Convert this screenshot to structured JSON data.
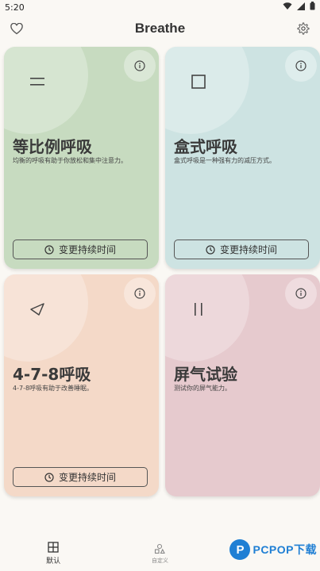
{
  "status": {
    "time": "5:20",
    "icons": [
      "wifi-icon",
      "signal-icon",
      "battery-icon"
    ]
  },
  "appbar": {
    "title": "Breathe",
    "left_icon": "heart-icon",
    "right_icon": "gear-icon"
  },
  "cards": [
    {
      "title": "等比例呼吸",
      "desc": "均衡的呼吸有助于你放松和集中注意力。",
      "button": "变更持续时间",
      "icon": "equal-icon",
      "color": "#c7dbc0"
    },
    {
      "title": "盒式呼吸",
      "desc": "盒式呼吸是一种强有力的减压方式。",
      "button": "变更持续时间",
      "icon": "square-icon",
      "color": "#cde3e2"
    },
    {
      "title": "4-7-8呼吸",
      "desc": "4-7-8呼吸有助于改善睡眠。",
      "button": "变更持续时间",
      "icon": "triangle-icon",
      "color": "#f4d9c8"
    },
    {
      "title": "屏气试验",
      "desc": "测试你的屏气能力。",
      "icon": "pause-icon",
      "color": "#e6cace"
    }
  ],
  "nav": {
    "items": [
      {
        "label": "默认",
        "icon": "grid-icon",
        "active": true
      },
      {
        "label": "自定义",
        "icon": "shapes-icon",
        "active": false
      }
    ]
  },
  "watermark": {
    "logo": "P",
    "text": "PCPOP下载"
  }
}
